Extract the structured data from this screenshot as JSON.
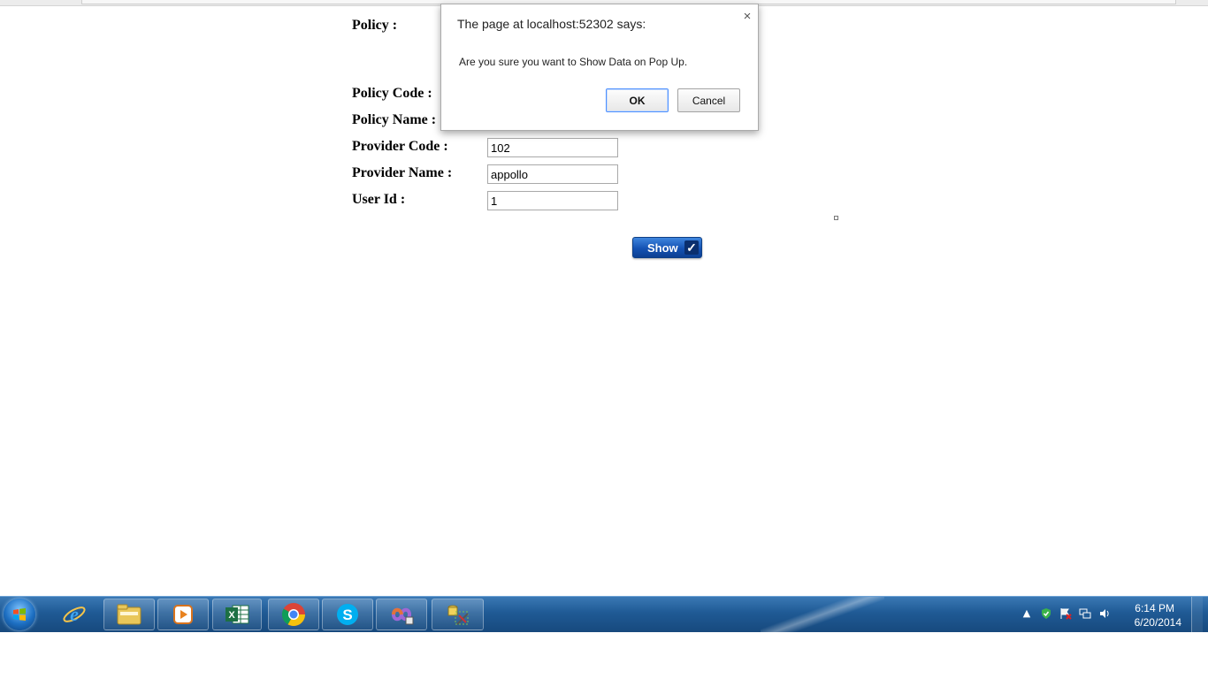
{
  "form": {
    "policy_label": "Policy :",
    "policy_code_label": "Policy Code :",
    "policy_name_label": "Policy Name :",
    "provider_code_label": "Provider Code :",
    "provider_code_value": "102",
    "provider_name_label": "Provider Name :",
    "provider_name_value": "appollo",
    "user_id_label": "User Id :",
    "user_id_value": "1",
    "show_label": "Show",
    "show_check": "✓"
  },
  "dialog": {
    "title": "The page at localhost:52302 says:",
    "message": "Are you sure you want to Show Data on Pop Up.",
    "ok_label": "OK",
    "cancel_label": "Cancel",
    "close_glyph": "×"
  },
  "taskbar": {
    "time": "6:14 PM",
    "date": "6/20/2014",
    "pinned_apps": [
      "internet-explorer",
      "windows-explorer",
      "media-player",
      "excel",
      "chrome",
      "skype",
      "visual-studio",
      "sql-tool"
    ]
  },
  "colors": {
    "taskbar": "#1f5a95",
    "show_button": "#1452b3",
    "dialog_ok_border": "#4d90fe"
  }
}
